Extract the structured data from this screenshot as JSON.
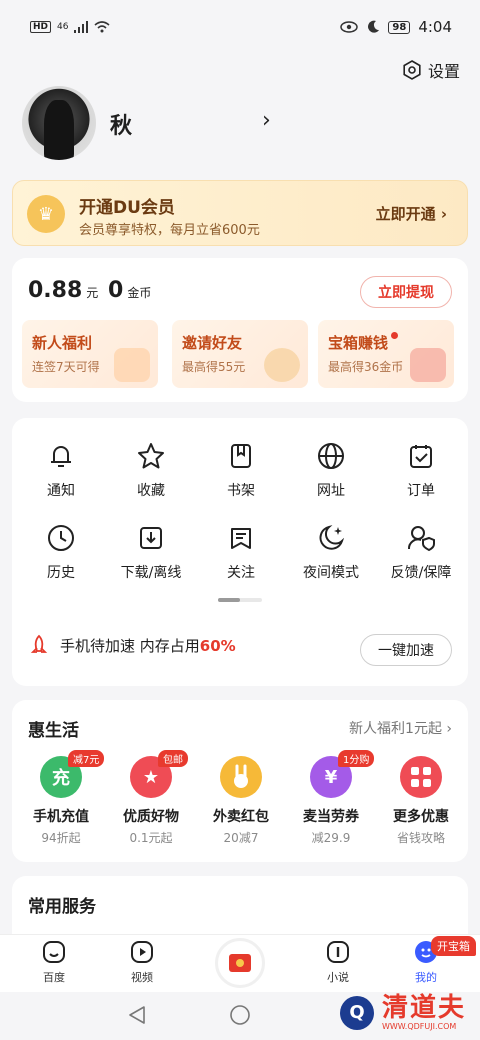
{
  "status_bar": {
    "hd": "HD",
    "signal": "46",
    "battery": "98",
    "time": "4:04"
  },
  "settings": {
    "label": "设置"
  },
  "profile": {
    "name": "秋"
  },
  "vip": {
    "title": "开通DU会员",
    "subtitle": "会员尊享特权，每月立省600元",
    "button": "立即开通 ›"
  },
  "wallet": {
    "cash": "0.88",
    "cash_unit": "元",
    "coins": "0",
    "coin_unit": "金币",
    "withdraw": "立即提现",
    "tiles": [
      {
        "title": "新人福利",
        "sub": "连签7天可得"
      },
      {
        "title": "邀请好友",
        "sub": "最高得55元"
      },
      {
        "title": "宝箱赚钱",
        "sub": "最高得36金币"
      }
    ]
  },
  "functions": [
    {
      "label": "通知",
      "icon": "bell-icon"
    },
    {
      "label": "收藏",
      "icon": "star-icon"
    },
    {
      "label": "书架",
      "icon": "bookmark-icon"
    },
    {
      "label": "网址",
      "icon": "globe-icon"
    },
    {
      "label": "订单",
      "icon": "order-icon"
    },
    {
      "label": "历史",
      "icon": "clock-icon"
    },
    {
      "label": "下载/离线",
      "icon": "download-icon"
    },
    {
      "label": "关注",
      "icon": "follow-icon"
    },
    {
      "label": "夜间模式",
      "icon": "moon-icon"
    },
    {
      "label": "反馈/保障",
      "icon": "feedback-icon"
    }
  ],
  "speed": {
    "text": "手机待加速 内存占用",
    "percent": "60%",
    "button": "一键加速"
  },
  "life": {
    "title": "惠生活",
    "more": "新人福利1元起 ›",
    "items": [
      {
        "name": "手机充值",
        "sub": "94折起",
        "badge": "减7元",
        "color": "#3cba6b",
        "glyph": "充"
      },
      {
        "name": "优质好物",
        "sub": "0.1元起",
        "badge": "包邮",
        "color": "#ef4c55",
        "glyph": "★"
      },
      {
        "name": "外卖红包",
        "sub": "20减7",
        "badge": "",
        "color": "#f6b938",
        "glyph": ""
      },
      {
        "name": "麦当劳券",
        "sub": "减29.9",
        "badge": "1分购",
        "color": "#a45be8",
        "glyph": "¥"
      },
      {
        "name": "更多优惠",
        "sub": "省钱攻略",
        "badge": "",
        "color": "#ef4c55",
        "glyph": ""
      }
    ]
  },
  "services": {
    "title": "常用服务"
  },
  "nav": {
    "tabs": [
      {
        "label": "百度",
        "icon": "home-icon"
      },
      {
        "label": "视频",
        "icon": "video-icon"
      },
      {
        "label": "小说",
        "icon": "novel-icon"
      },
      {
        "label": "我的",
        "icon": "mine-icon"
      }
    ],
    "treasure": "开宝箱"
  },
  "watermark": {
    "logo": "Q",
    "text": "清道夫",
    "url": "WWW.QDFUJI.COM"
  }
}
